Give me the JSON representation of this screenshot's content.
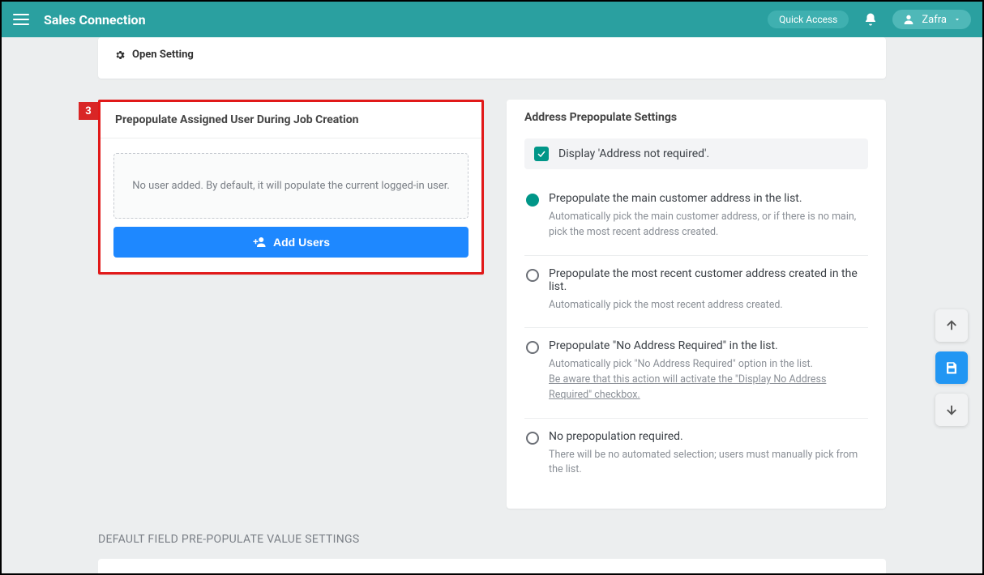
{
  "header": {
    "brand": "Sales Connection",
    "quick_access": "Quick Access",
    "user_name": "Zafra"
  },
  "top_card": {
    "open_setting_label": "Open Setting"
  },
  "step_badge": "3",
  "left_card": {
    "title": "Prepopulate Assigned User During Job Creation",
    "empty_text": "No user added. By default, it will populate the current logged-in user.",
    "add_users_label": "Add Users"
  },
  "right_card": {
    "title": "Address Prepopulate Settings",
    "checkbox_label": "Display 'Address not required'.",
    "options": [
      {
        "title": "Prepopulate the main customer address in the list.",
        "desc": "Automatically pick the main customer address, or if there is no main, pick the most recent address created.",
        "warn": ""
      },
      {
        "title": "Prepopulate the most recent customer address created in the list.",
        "desc": "Automatically pick the most recent address created.",
        "warn": ""
      },
      {
        "title": "Prepopulate \"No Address Required\" in the list.",
        "desc": "Automatically pick \"No Address Required\" option in the list.",
        "warn": "Be aware that this action will activate the \"Display No Address Required\" checkbox."
      },
      {
        "title": "No prepopulation required.",
        "desc": "There will be no automated selection; users must manually pick from the list.",
        "warn": ""
      }
    ]
  },
  "section_title": "DEFAULT FIELD PRE-POPULATE VALUE SETTINGS"
}
